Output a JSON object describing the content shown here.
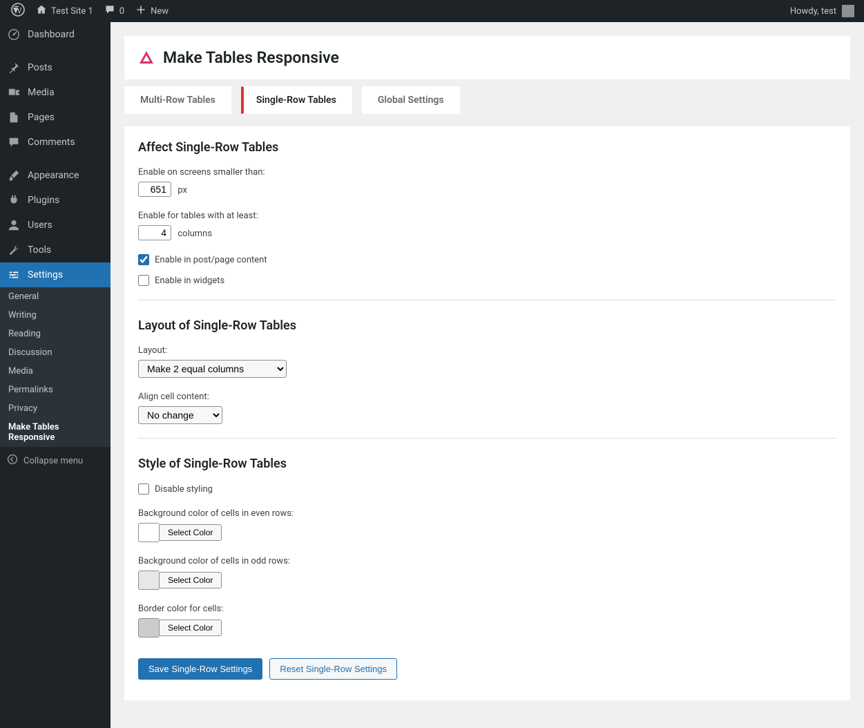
{
  "adminbar": {
    "site_name": "Test Site 1",
    "comments_count": "0",
    "new_label": "New",
    "howdy": "Howdy, test"
  },
  "sidebar": {
    "items": [
      {
        "label": "Dashboard",
        "icon": "dash"
      },
      {
        "label": "Posts",
        "icon": "pin"
      },
      {
        "label": "Media",
        "icon": "media"
      },
      {
        "label": "Pages",
        "icon": "page"
      },
      {
        "label": "Comments",
        "icon": "comment"
      },
      {
        "label": "Appearance",
        "icon": "brush"
      },
      {
        "label": "Plugins",
        "icon": "plug"
      },
      {
        "label": "Users",
        "icon": "user"
      },
      {
        "label": "Tools",
        "icon": "wrench"
      },
      {
        "label": "Settings",
        "icon": "sliders"
      }
    ],
    "settings_sub": [
      "General",
      "Writing",
      "Reading",
      "Discussion",
      "Media",
      "Permalinks",
      "Privacy",
      "Make Tables Responsive"
    ],
    "collapse_label": "Collapse menu"
  },
  "page": {
    "title": "Make Tables Responsive",
    "tabs": [
      "Multi-Row Tables",
      "Single-Row Tables",
      "Global Settings"
    ]
  },
  "section1": {
    "heading": "Affect Single-Row Tables",
    "enable_smaller_label": "Enable on screens smaller than:",
    "smaller_value": "651",
    "smaller_unit": "px",
    "enable_atleast_label": "Enable for tables with at least:",
    "atleast_value": "4",
    "atleast_unit": "columns",
    "cb_content": "Enable in post/page content",
    "cb_widgets": "Enable in widgets"
  },
  "section2": {
    "heading": "Layout of Single-Row Tables",
    "layout_label": "Layout:",
    "layout_value": "Make 2 equal columns",
    "align_label": "Align cell content:",
    "align_value": "No change"
  },
  "section3": {
    "heading": "Style of Single-Row Tables",
    "cb_disable": "Disable styling",
    "bg_even_label": "Background color of cells in even rows:",
    "bg_odd_label": "Background color of cells in odd rows:",
    "border_label": "Border color for cells:",
    "select_color": "Select Color",
    "swatch_even": "#ffffff",
    "swatch_odd": "#e7e7e7",
    "swatch_border": "#cccccc"
  },
  "buttons": {
    "save": "Save Single-Row Settings",
    "reset": "Reset Single-Row Settings"
  }
}
